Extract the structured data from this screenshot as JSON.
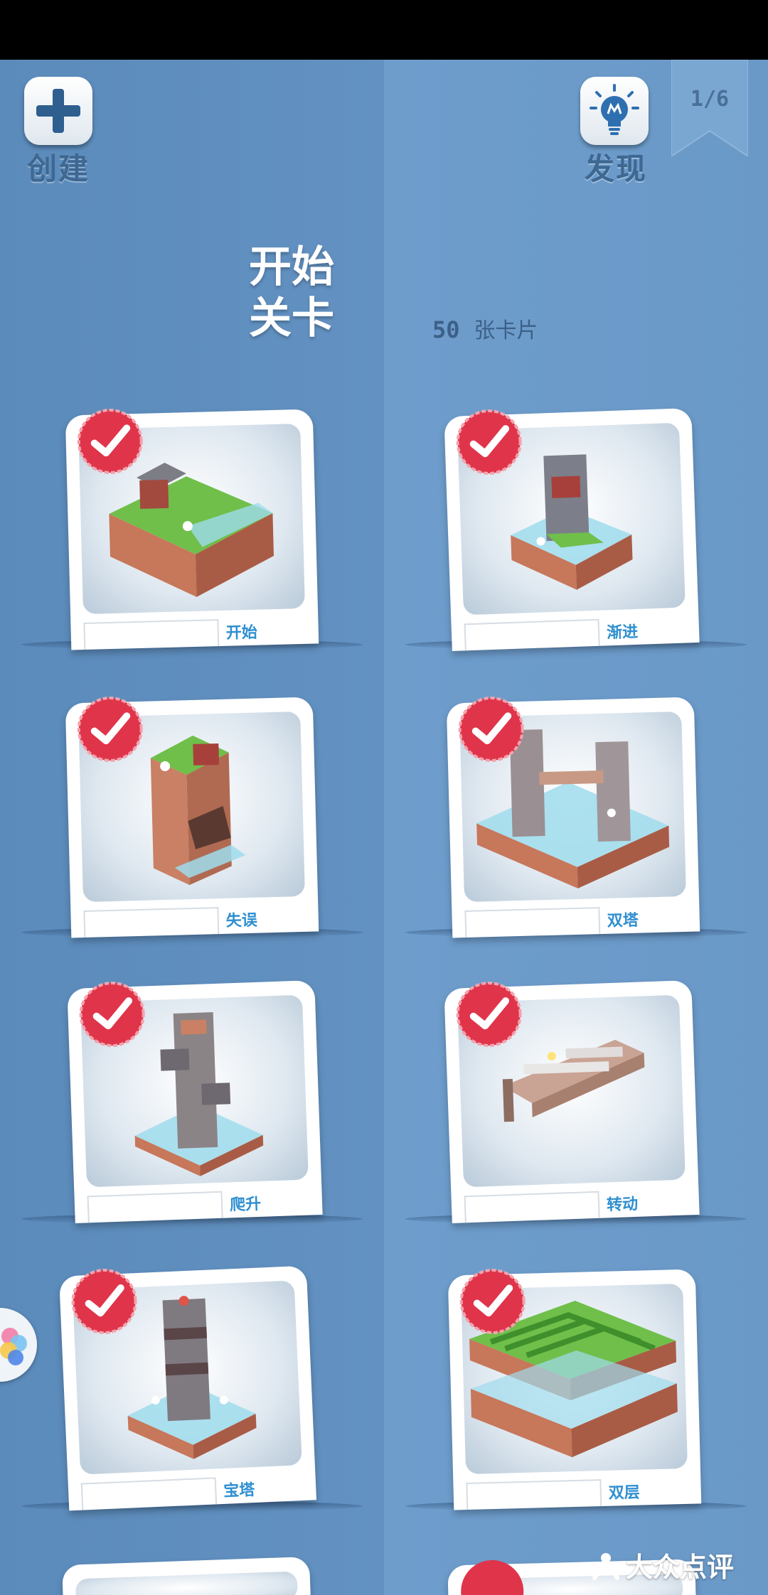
{
  "header": {
    "create_label": "创建",
    "discover_label": "发现",
    "page_indicator": "1/6"
  },
  "section": {
    "title_line1": "开始",
    "title_line2": "关卡",
    "card_count_number": "50",
    "card_count_unit": "张卡片"
  },
  "levels": [
    {
      "name": "开始",
      "completed": true
    },
    {
      "name": "渐进",
      "completed": true
    },
    {
      "name": "失误",
      "completed": true
    },
    {
      "name": "双塔",
      "completed": true
    },
    {
      "name": "爬升",
      "completed": true
    },
    {
      "name": "转动",
      "completed": true
    },
    {
      "name": "宝塔",
      "completed": true
    },
    {
      "name": "双层",
      "completed": true
    }
  ],
  "watermark": "大众点评",
  "colors": {
    "accent_blue": "#3e6791",
    "badge_red": "#e0344a",
    "level_name": "#2f8fd0"
  }
}
